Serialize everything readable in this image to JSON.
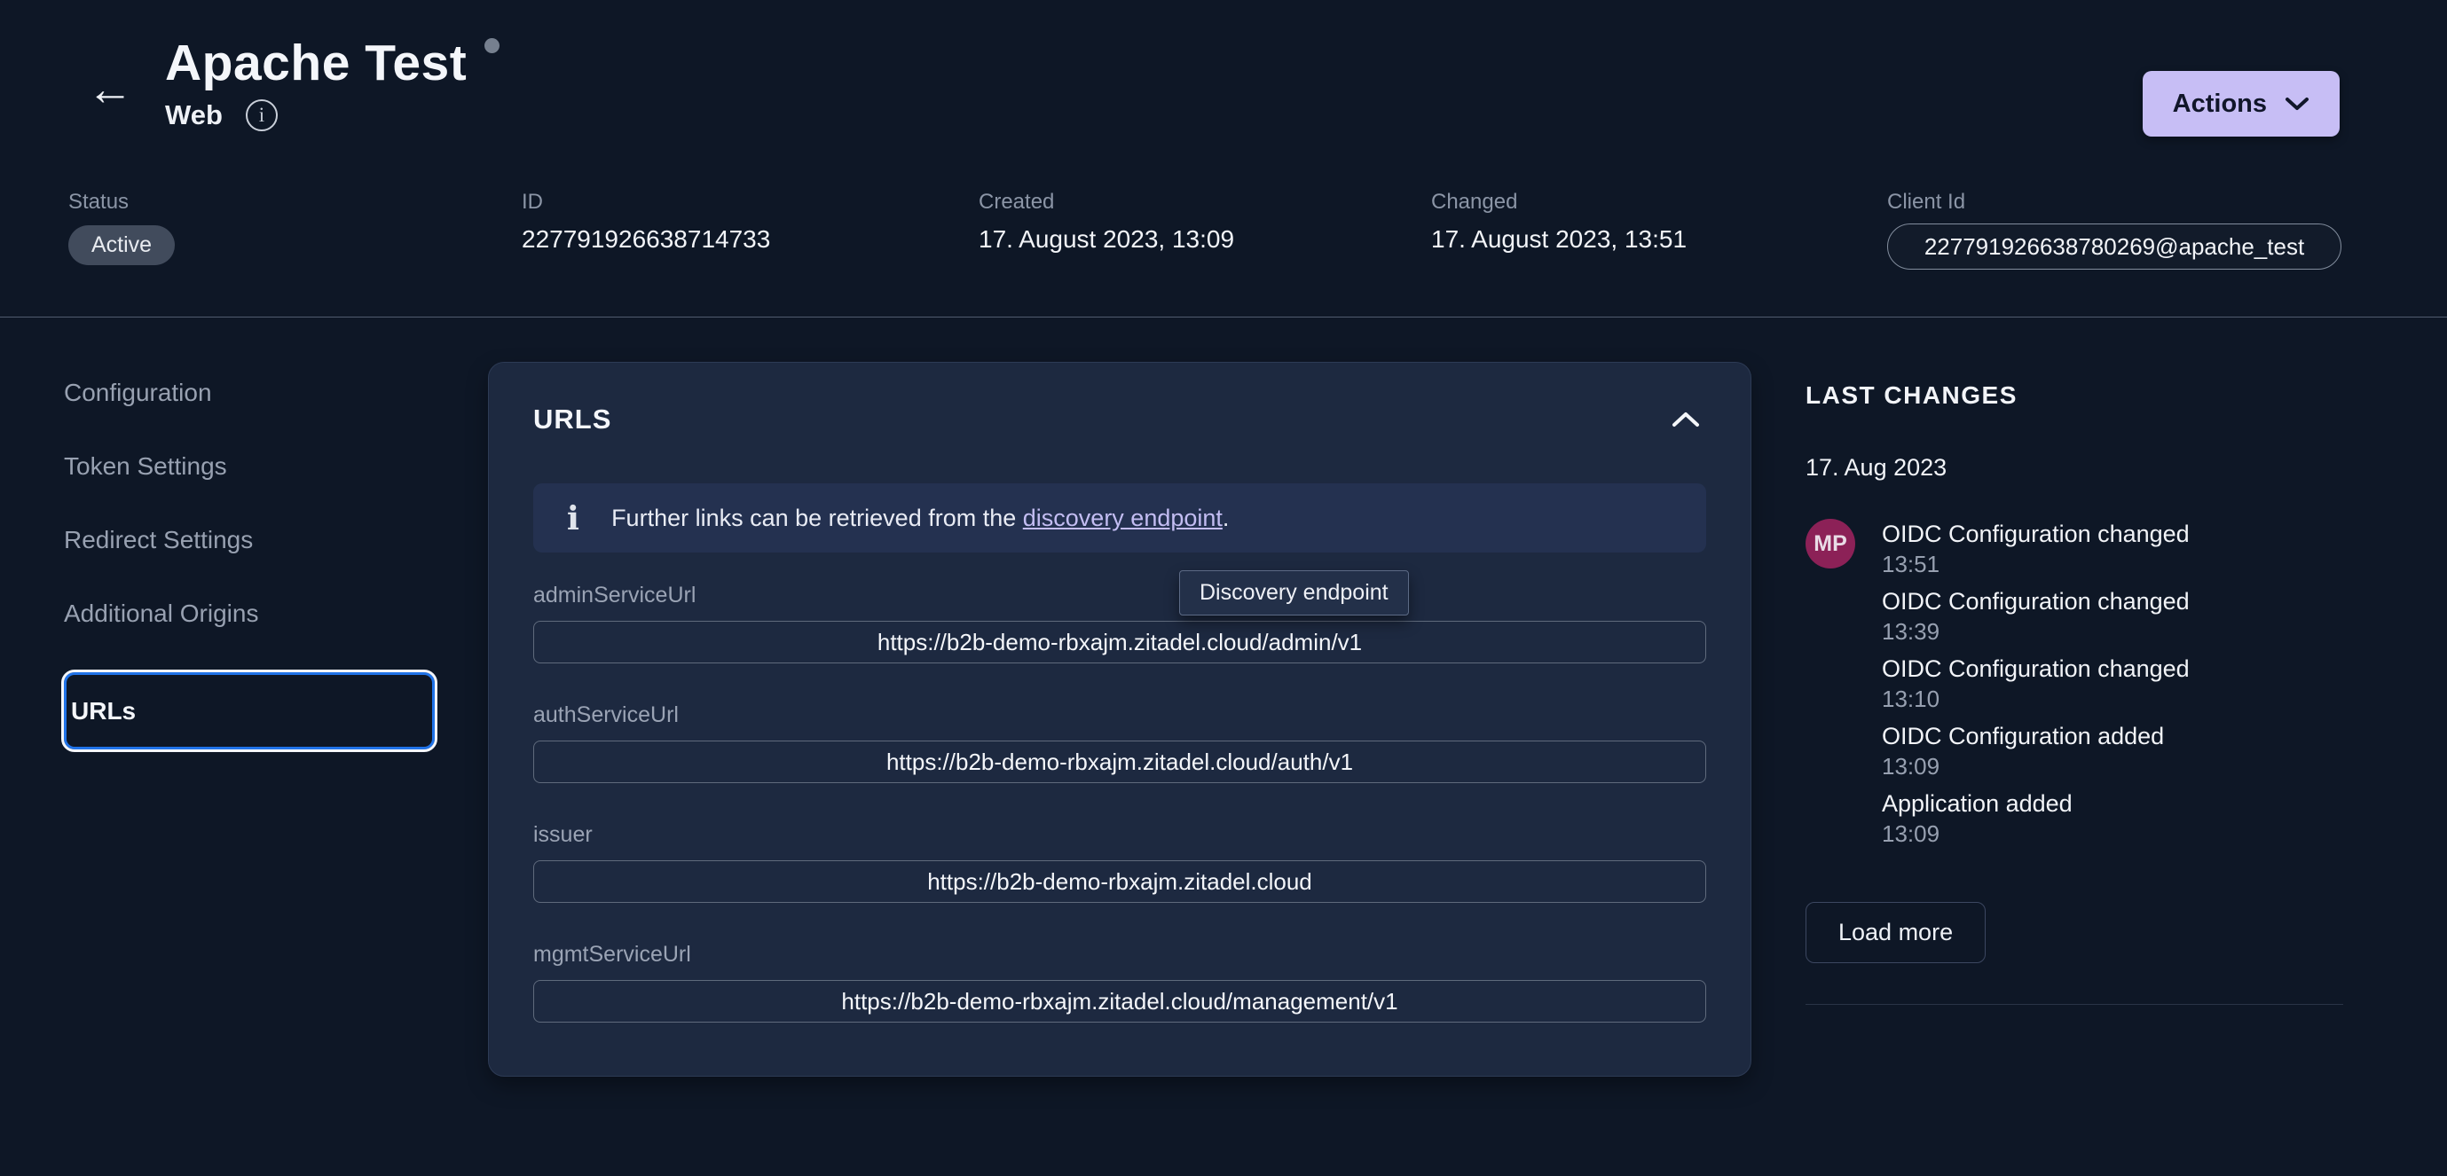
{
  "header": {
    "title": "Apache Test",
    "subtitle": "Web",
    "actions_label": "Actions"
  },
  "meta": {
    "status_label": "Status",
    "status_value": "Active",
    "id_label": "ID",
    "id_value": "227791926638714733",
    "created_label": "Created",
    "created_value": "17. August 2023, 13:09",
    "changed_label": "Changed",
    "changed_value": "17. August 2023, 13:51",
    "client_id_label": "Client Id",
    "client_id_value": "227791926638780269@apache_test"
  },
  "sidebar": {
    "items": [
      {
        "label": "Configuration"
      },
      {
        "label": "Token Settings"
      },
      {
        "label": "Redirect Settings"
      },
      {
        "label": "Additional Origins"
      },
      {
        "label": "URLs"
      }
    ]
  },
  "urls_panel": {
    "title": "URLS",
    "info_icon": "info-icon",
    "info_text_before": "Further links can be retrieved from the ",
    "info_link_text": "discovery endpoint",
    "info_text_after": ".",
    "tooltip_text": "Discovery endpoint",
    "fields": [
      {
        "label": "adminServiceUrl",
        "value": "https://b2b-demo-rbxajm.zitadel.cloud/admin/v1"
      },
      {
        "label": "authServiceUrl",
        "value": "https://b2b-demo-rbxajm.zitadel.cloud/auth/v1"
      },
      {
        "label": "issuer",
        "value": "https://b2b-demo-rbxajm.zitadel.cloud"
      },
      {
        "label": "mgmtServiceUrl",
        "value": "https://b2b-demo-rbxajm.zitadel.cloud/management/v1"
      }
    ]
  },
  "changes_panel": {
    "title": "LAST CHANGES",
    "date": "17. Aug 2023",
    "avatar_initials": "MP",
    "entries": [
      {
        "title": "OIDC Configuration changed",
        "time": "13:51"
      },
      {
        "title": "OIDC Configuration changed",
        "time": "13:39"
      },
      {
        "title": "OIDC Configuration changed",
        "time": "13:10"
      },
      {
        "title": "OIDC Configuration added",
        "time": "13:09"
      },
      {
        "title": "Application added",
        "time": "13:09"
      }
    ],
    "load_more_label": "Load more"
  },
  "colors": {
    "page_background": "#0e1726",
    "card_background": "#1d2940",
    "banner_background": "#243150",
    "accent_button": "#c7bef5",
    "active_nav_border": "#2073e8",
    "link": "#c3bdf2",
    "avatar_background": "#8c2157",
    "status_badge_background": "#414b5c"
  }
}
